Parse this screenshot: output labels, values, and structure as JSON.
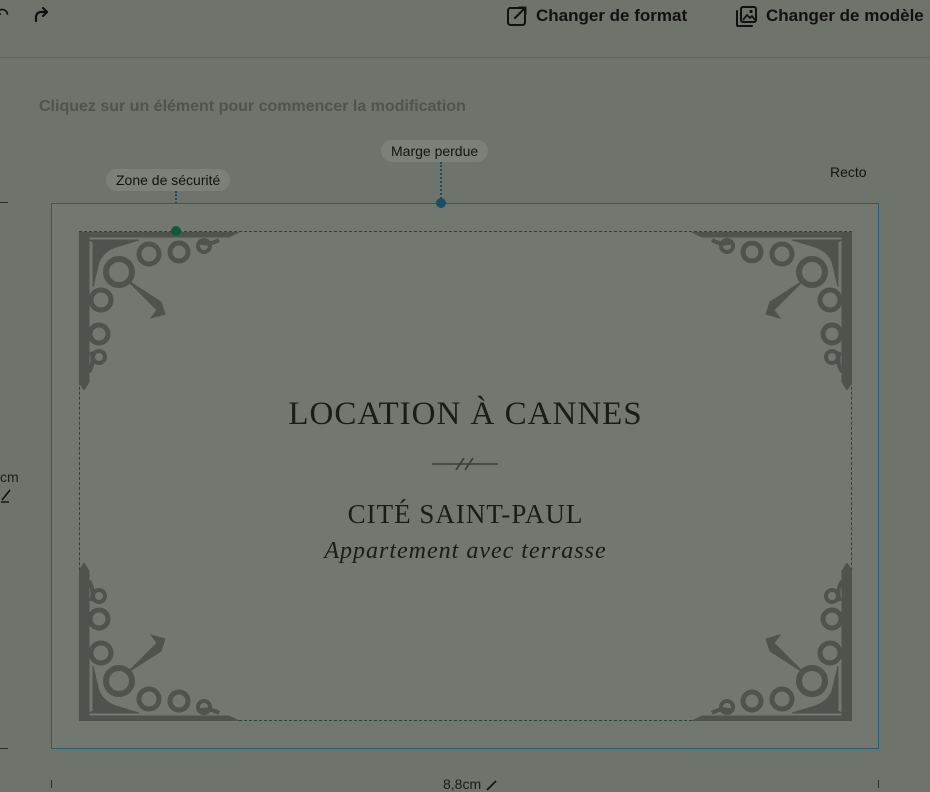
{
  "toolbar": {
    "undo_glyph": "↶",
    "change_format_label": "Changer de format",
    "change_template_label": "Changer de modèle"
  },
  "editor": {
    "hint": "Cliquez sur un élément pour commencer la modification",
    "bleed_label": "Marge perdue",
    "safe_zone_label": "Zone de sécurité",
    "side_label": "Recto",
    "height_measure": "cm",
    "width_measure": "8,8cm"
  },
  "card": {
    "title": "LOCATION À CANNES",
    "subtitle": "CITÉ SAINT-PAUL",
    "tagline": "Appartement avec terrasse"
  },
  "colors": {
    "bleed_marker": "#1f4c68",
    "safe_marker": "#0f5a3a",
    "ornament": "#4f534e"
  }
}
